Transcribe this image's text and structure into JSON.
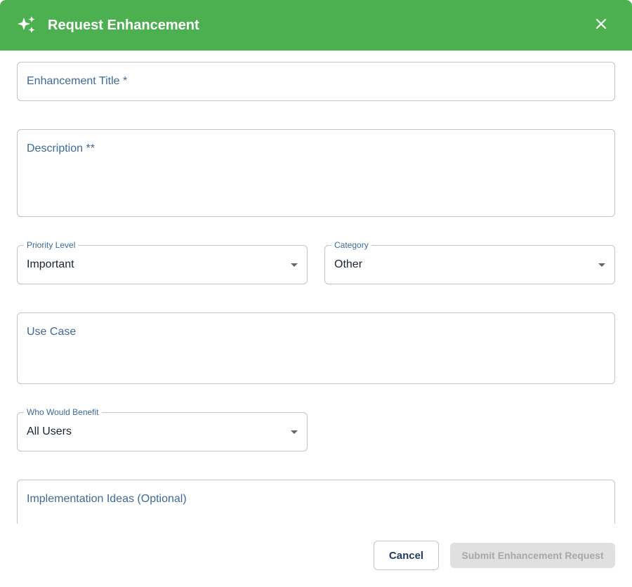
{
  "dialog": {
    "title": "Request Enhancement",
    "header_icon": "sparkles-icon",
    "close_icon": "close-icon",
    "header_color": "#4caf50"
  },
  "form": {
    "title_placeholder": "Enhancement Title *",
    "description_placeholder": "Description **",
    "priority": {
      "label": "Priority Level",
      "value": "Important"
    },
    "category": {
      "label": "Category",
      "value": "Other"
    },
    "use_case_placeholder": "Use Case",
    "beneficiaries": {
      "label": "Who Would Benefit",
      "value": "All Users"
    },
    "implementation_placeholder": "Implementation Ideas (Optional)"
  },
  "footer": {
    "cancel_label": "Cancel",
    "submit_label": "Submit Enhancement Request",
    "submit_disabled": true
  }
}
